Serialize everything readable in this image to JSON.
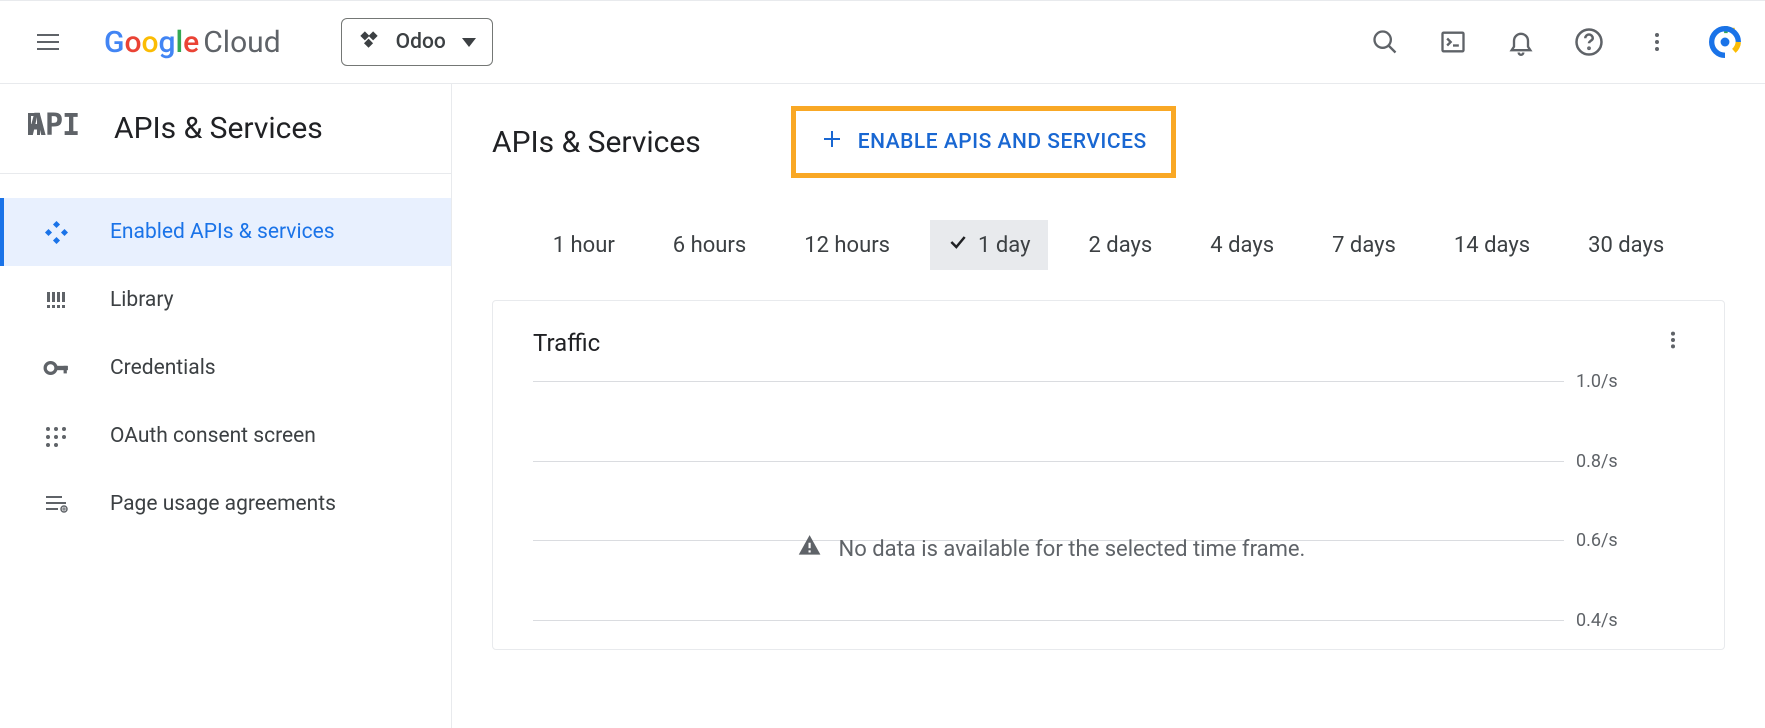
{
  "header": {
    "logo_google": "Google",
    "logo_cloud": "Cloud",
    "project_name": "Odoo"
  },
  "sidebar": {
    "section_title": "APIs & Services",
    "items": [
      {
        "label": "Enabled APIs & services",
        "active": true
      },
      {
        "label": "Library",
        "active": false
      },
      {
        "label": "Credentials",
        "active": false
      },
      {
        "label": "OAuth consent screen",
        "active": false
      },
      {
        "label": "Page usage agreements",
        "active": false
      }
    ]
  },
  "main": {
    "title": "APIs & Services",
    "enable_button": "ENABLE APIS AND SERVICES",
    "time_filters": [
      "1 hour",
      "6 hours",
      "12 hours",
      "1 day",
      "2 days",
      "4 days",
      "7 days",
      "14 days",
      "30 days"
    ],
    "time_selected": "1 day",
    "card": {
      "title": "Traffic",
      "no_data_msg": "No data is available for the selected time frame."
    }
  },
  "chart_data": {
    "type": "line",
    "title": "Traffic",
    "xlabel": "",
    "ylabel": "",
    "ylim": [
      0.4,
      1.0
    ],
    "y_ticks": [
      "1.0/s",
      "0.8/s",
      "0.6/s",
      "0.4/s"
    ],
    "series": [],
    "note": "No data is available for the selected time frame."
  }
}
